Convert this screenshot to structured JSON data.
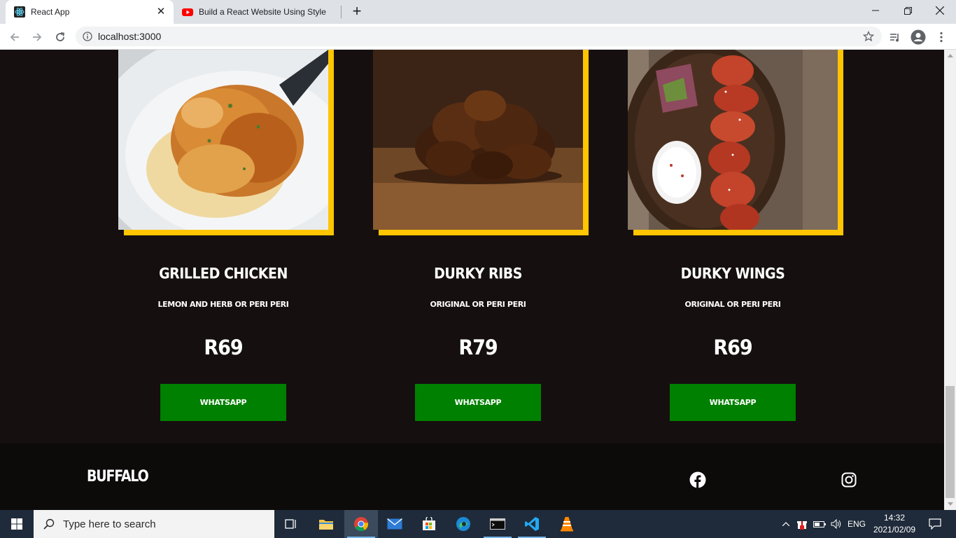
{
  "browser": {
    "tabs": [
      {
        "title": "React App",
        "favicon": "react-icon"
      },
      {
        "title": "Build a React Website Using Style",
        "favicon": "youtube-icon"
      }
    ],
    "new_tab_label": "+",
    "url": "localhost:3000"
  },
  "menu": [
    {
      "title": "GRILLED CHICKEN",
      "desc": "LEMON AND HERB OR PERI PERI",
      "price": "R69",
      "button": "WHATSAPP",
      "image": "grilled-chicken-photo"
    },
    {
      "title": "DURKY RIBS",
      "desc": "ORIGINAL OR PERI PERI",
      "price": "R79",
      "button": "WHATSAPP",
      "image": "ribs-photo"
    },
    {
      "title": "DURKY WINGS",
      "desc": "ORIGINAL OR PERI PERI",
      "price": "R69",
      "button": "WHATSAPP",
      "image": "wings-photo"
    }
  ],
  "footer": {
    "logo": "BUFFALO",
    "social": [
      "facebook-icon",
      "instagram-icon"
    ]
  },
  "colors": {
    "page_bg": "#150f0f",
    "footer_bg": "#0d0a0a",
    "accent_yellow": "#ffc500",
    "button_green": "#008000"
  },
  "taskbar": {
    "search_placeholder": "Type here to search",
    "language": "ENG",
    "time": "14:32",
    "date": "2021/02/09"
  }
}
